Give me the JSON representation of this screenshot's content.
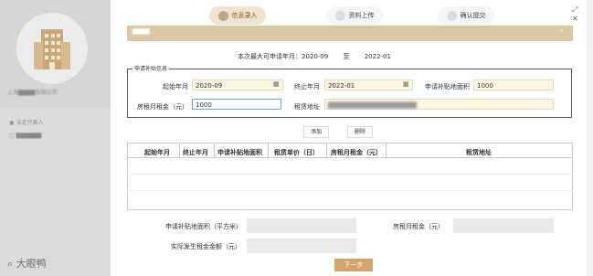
{
  "steps": [
    "信息录入",
    "资料上传",
    "确认提交"
  ],
  "summary": {
    "prefix": "本次最大可申请年月：",
    "start": "2020-09",
    "sep": "至",
    "end": "2022-01"
  },
  "fieldset_legend": "申请补贴信息",
  "form": {
    "start_label": "起始年月",
    "start_value": "2020-09",
    "end_label": "终止年月",
    "end_value": "2022-01",
    "area_label": "申请补贴地面积",
    "area_value": "1000",
    "rent_label": "房租月租金（元）",
    "rent_value": "1000",
    "address_label": "租赁地址"
  },
  "buttons": {
    "add": "添加",
    "delete": "删除",
    "next": "下一步"
  },
  "table_headers": [
    "起始年月",
    "终止年月",
    "申请补贴地面积",
    "租赁单价（日）",
    "房租月租金（元）",
    "租赁地址"
  ],
  "summary_fields": {
    "area_label": "申请补贴地面积（平方米）",
    "rent_label": "房租月租金（元）",
    "actual_label": "实际发生租金金额（元）"
  },
  "left": {
    "label": "法定代表人"
  },
  "brand": "大眼鸭",
  "icons": {
    "calendar": "calendar-icon",
    "collapse": "chevron-up-icon",
    "maximize": "maximize-icon",
    "close": "close-icon"
  }
}
